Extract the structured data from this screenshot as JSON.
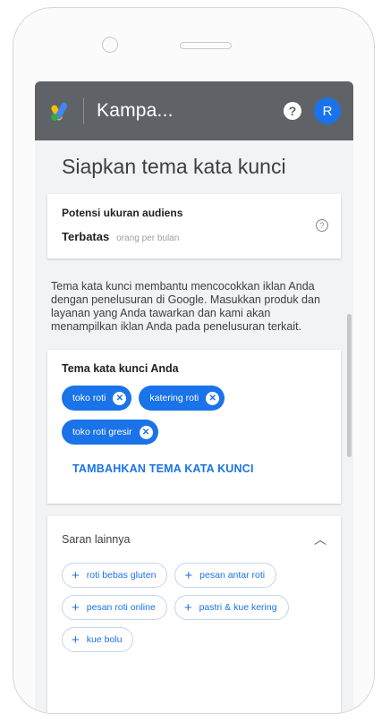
{
  "app": {
    "title": "Kampa...",
    "help_icon": "help-circle-icon",
    "avatar_initial": "R",
    "accent": "#1a73e8",
    "appbar_color": "#5f6368"
  },
  "page": {
    "heading": "Siapkan tema kata kunci"
  },
  "audience": {
    "label": "Potensi ukuran audiens",
    "value": "Terbatas",
    "sub": "orang per bulan"
  },
  "description": "Tema kata kunci membantu mencocokkan iklan Anda dengan penelusuran di Google. Masukkan produk dan layanan yang Anda tawarkan dan kami akan menampilkan iklan Anda pada penelusuran terkait.",
  "themes": {
    "label": "Tema kata kunci Anda",
    "chips": [
      "toko roti",
      "katering roti",
      "toko roti gresir"
    ],
    "add_label": "TAMBAHKAN TEMA KATA KUNCI"
  },
  "suggestions": {
    "label": "Saran lainnya",
    "chips": [
      "roti bebas gluten",
      "pesan antar roti",
      "pesan roti online",
      "pastri & kue kering",
      "kue bolu"
    ]
  }
}
